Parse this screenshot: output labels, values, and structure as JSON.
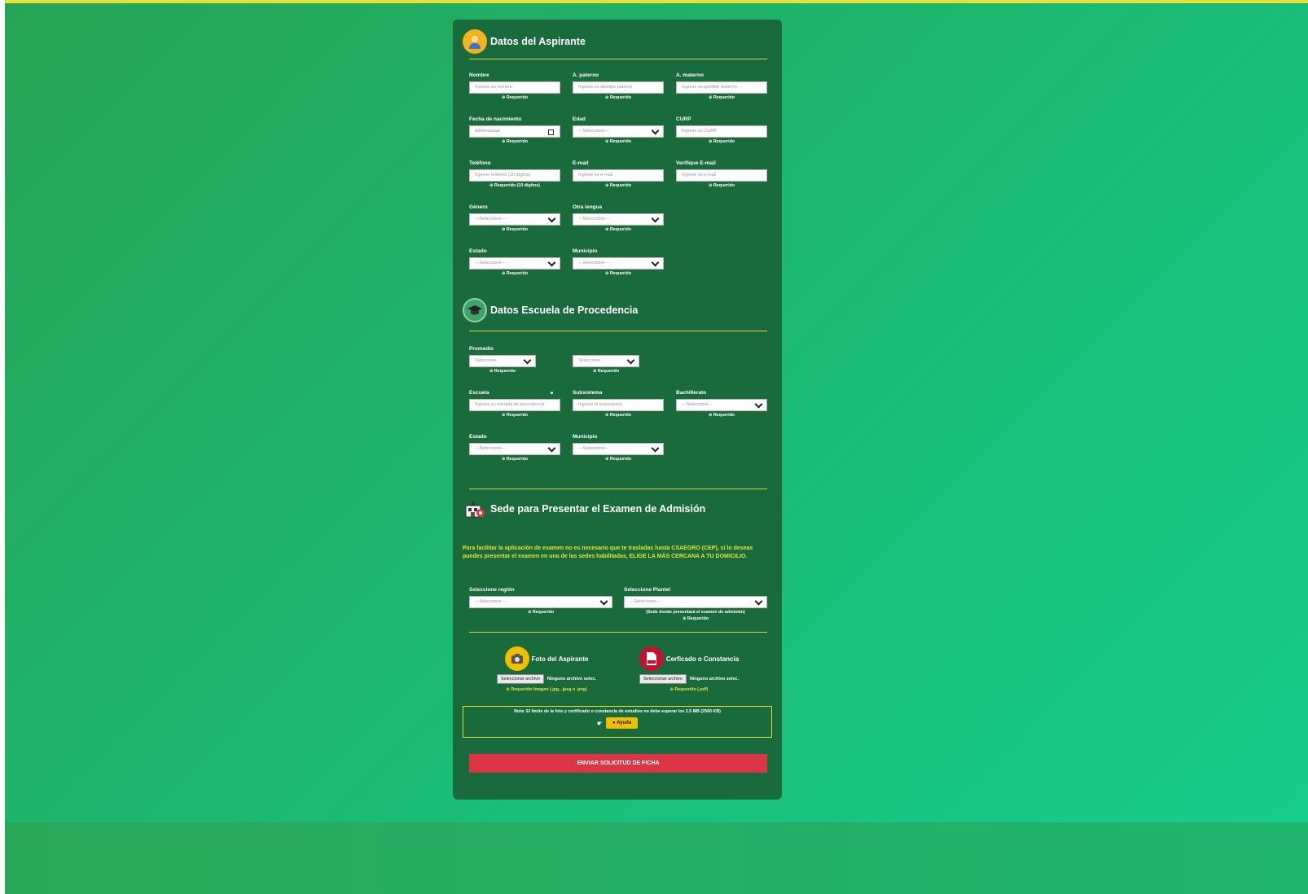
{
  "colors": {
    "background": "#1bbb74",
    "card": "#1a6b3c",
    "accent": "#e6e23a",
    "submit": "#dc3545"
  },
  "sections": {
    "aspirante": {
      "title": "Datos del Aspirante",
      "icon": "person-icon"
    },
    "escuela": {
      "title": "Datos Escuela de Procedencia",
      "icon": "graduation-cap-icon"
    },
    "sede": {
      "title": "Sede para Presentar el Examen de Admisión",
      "icon": "building-icon"
    }
  },
  "aspirante_fields": {
    "nombre": {
      "label": "Nombre",
      "placeholder": "Ingrese su nombre",
      "req": "Requerido"
    },
    "paterno": {
      "label": "A. paterno",
      "placeholder": "Ingrese su apellido paterno",
      "req": "Requerido"
    },
    "materno": {
      "label": "A. materno",
      "placeholder": "Ingrese su apellido materno",
      "req": "Requerido"
    },
    "nacimiento": {
      "label": "Fecha de nacimiento",
      "placeholder": "dd/mm/aaaa",
      "req": "Requerido"
    },
    "edad": {
      "label": "Edad",
      "value": "---Seleccione---",
      "req": "Requerido"
    },
    "curp": {
      "label": "CURP",
      "placeholder": "Ingrese su CURP",
      "req": "Requerido"
    },
    "telefono": {
      "label": "Teléfono",
      "placeholder": "Ingrese teléfono (10 dígitos)",
      "req": "Requerido (10 dígitos)"
    },
    "email": {
      "label": "E-mail",
      "placeholder": "Ingrese su e-mail",
      "req": "Requerido"
    },
    "verif_email": {
      "label": "Verifique E-mail",
      "placeholder": "Ingrese su e-mail",
      "req": "Requerido"
    },
    "genero": {
      "label": "Género",
      "value": "---Seleccione---",
      "req": "Requerido"
    },
    "lengua": {
      "label": "Otra lengua",
      "value": "---Seleccione---",
      "req": "Requerido"
    },
    "estado": {
      "label": "Estado",
      "value": "---Seleccione---",
      "req": "Requerido"
    },
    "municipio": {
      "label": "Municipio",
      "value": "---Seleccione---",
      "req": "Requerido"
    }
  },
  "escuela_fields": {
    "promedio": {
      "label": "Promedio",
      "value1": "Seleccione",
      "value2": "Seleccione",
      "req": "Requerido"
    },
    "escuela": {
      "label": "Escuela",
      "placeholder": "Ingrese su escuela de procedencia",
      "req": "Requerido"
    },
    "subsistema": {
      "label": "Subsistema",
      "placeholder": "Ingrese el subsistema",
      "req": "Requerido"
    },
    "bachillerato": {
      "label": "Bachillerato",
      "value": "---Seleccione---",
      "req": "Requerido"
    },
    "estado": {
      "label": "Estado",
      "value": "---Seleccione---",
      "req": "Requerido"
    },
    "municipio": {
      "label": "Municipio",
      "value": "---Seleccione---",
      "req": "Requerido"
    }
  },
  "sede": {
    "notice": "Para facilitar la aplicación de examen no es necesario que te trasladas hasta CSAEGRO (CEP), si lo deseas puedes presentar el examen en una de las sedes habilitadas, ELIGE LA MÁS CERCANA A TU DOMICILIO.",
    "region": {
      "label": "Seleccione región",
      "value": "---Seleccione---",
      "req": "Requerido"
    },
    "plantel": {
      "label": "Seleccione Plantel",
      "value": "---Seleccione---",
      "hint": "(Sede donde presentará el examen de admisión)",
      "req": "Requerido"
    }
  },
  "uploads": {
    "foto": {
      "title": "Foto del Aspirante",
      "button": "Seleccionar archivo",
      "status": "Ninguno archivo selec.",
      "req": "Requerido Imagen (.jpg, .jpeg o .png)"
    },
    "certificado": {
      "title": "Cerficado o Constancia",
      "button": "Seleccionar archivo",
      "status": "Ninguno archivo selec.",
      "req": "Requerido (.pdf)"
    }
  },
  "note": {
    "text": "Nota: El límite de la foto y certificado o constancia de estudios no debe esperar los 2.5 MB (2560 KB)",
    "help": "Ayuda"
  },
  "submit_label": "ENVIAR SOLICITUD DE FICHA"
}
